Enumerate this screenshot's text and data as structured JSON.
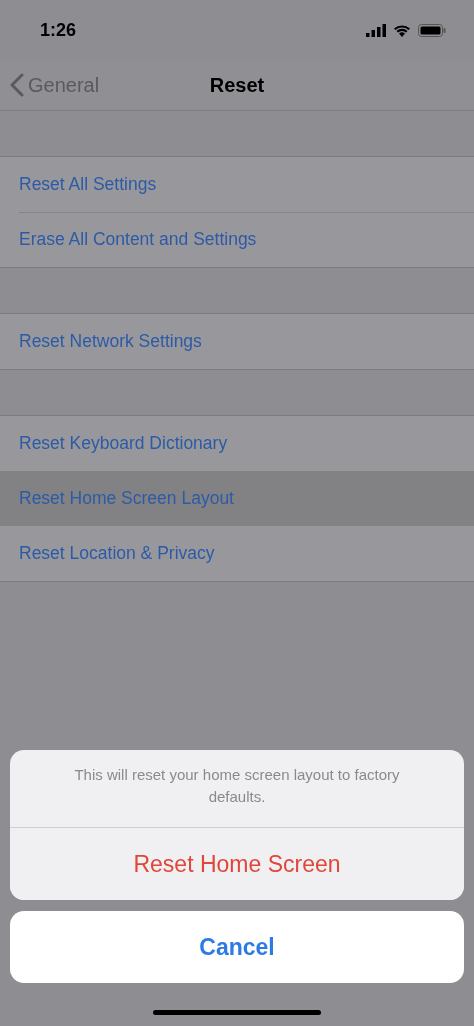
{
  "status_bar": {
    "time": "1:26"
  },
  "nav": {
    "back_label": "General",
    "title": "Reset"
  },
  "groups": [
    {
      "rows": [
        {
          "label": "Reset All Settings",
          "selected": false
        },
        {
          "label": "Erase All Content and Settings",
          "selected": false
        }
      ]
    },
    {
      "rows": [
        {
          "label": "Reset Network Settings",
          "selected": false
        }
      ]
    },
    {
      "rows": [
        {
          "label": "Reset Keyboard Dictionary",
          "selected": false
        },
        {
          "label": "Reset Home Screen Layout",
          "selected": true
        },
        {
          "label": "Reset Location & Privacy",
          "selected": false
        }
      ]
    }
  ],
  "action_sheet": {
    "message": "This will reset your home screen layout to factory defaults.",
    "action": "Reset Home Screen",
    "cancel": "Cancel"
  }
}
